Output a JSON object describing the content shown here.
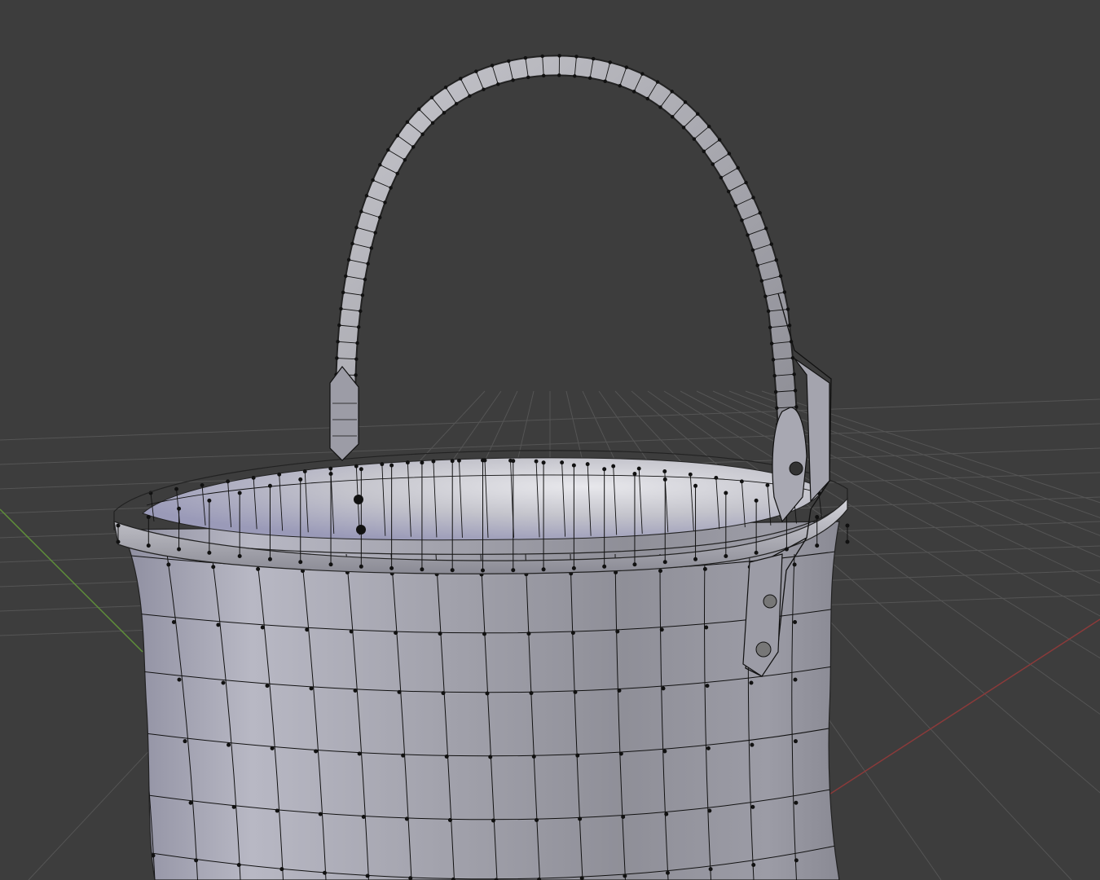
{
  "viewport": {
    "view": "perspective",
    "mode": "edit-mode-wireframe-overlay",
    "background_color": "#3d3d3d",
    "grid_color": "#555555",
    "x_axis_color": "#8b3a3a",
    "y_axis_color": "#5f8f3a",
    "wire_color": "#111111",
    "object": {
      "name_icon": "mesh-object-icon",
      "parts": [
        "bucket-body",
        "bucket-rim",
        "bucket-handle",
        "left-handle-bracket",
        "right-handle-bracket"
      ]
    }
  }
}
